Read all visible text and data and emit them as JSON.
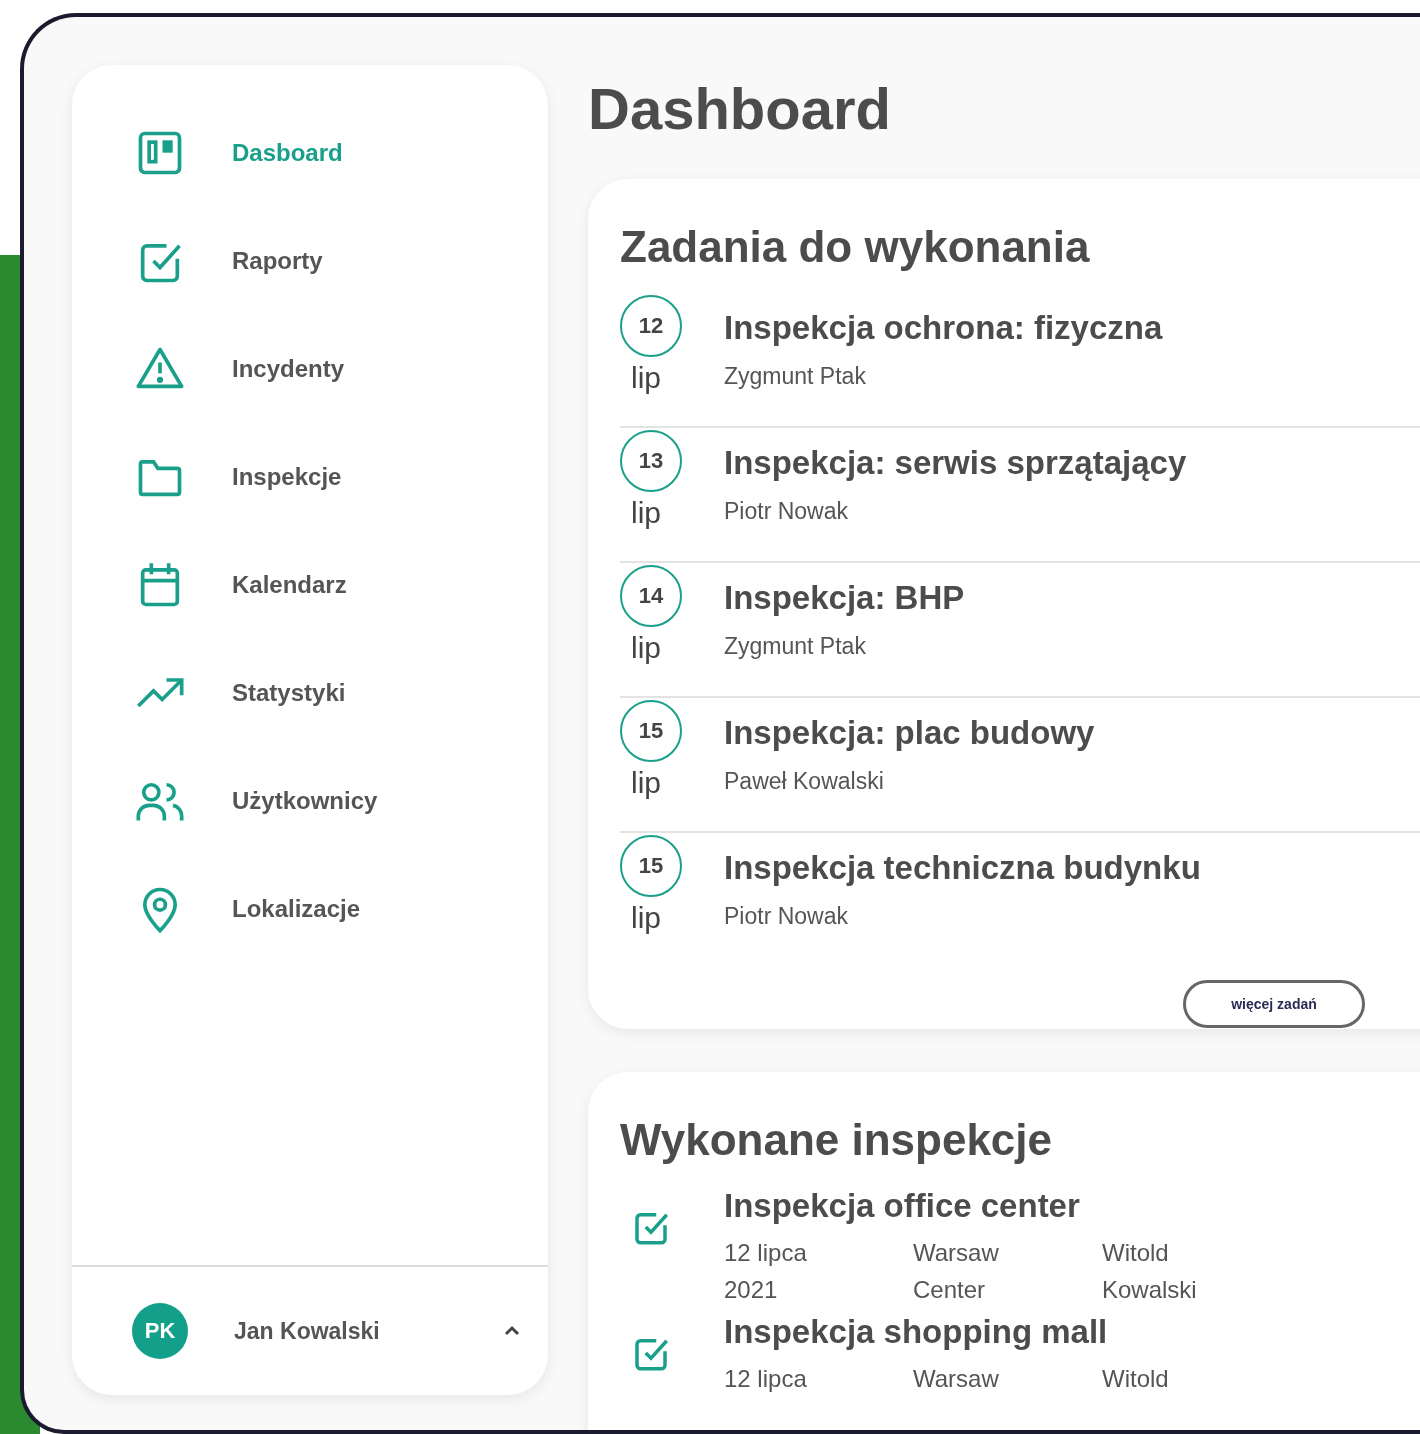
{
  "sidebar": {
    "items": [
      {
        "label": "Dasboard",
        "kind": "board",
        "selected": true
      },
      {
        "label": "Raporty",
        "kind": "check",
        "selected": false
      },
      {
        "label": "Incydenty",
        "kind": "warning",
        "selected": false
      },
      {
        "label": "Inspekcje",
        "kind": "folder",
        "selected": false
      },
      {
        "label": "Kalendarz",
        "kind": "calendar",
        "selected": false
      },
      {
        "label": "Statystyki",
        "kind": "trend",
        "selected": false
      },
      {
        "label": "Użytkownicy",
        "kind": "users",
        "selected": false
      },
      {
        "label": "Lokalizacje",
        "kind": "pin",
        "selected": false
      }
    ],
    "user": {
      "initials": "PK",
      "name": "Jan Kowalski"
    }
  },
  "page_title": "Dashboard",
  "tasks": {
    "title": "Zadania do wykonania",
    "items": [
      {
        "day": "12",
        "month": "lip",
        "title": "Inspekcja ochrona: fizyczna",
        "assignee": "Zygmunt Ptak"
      },
      {
        "day": "13",
        "month": "lip",
        "title": "Inspekcja: serwis sprzątający",
        "assignee": "Piotr Nowak"
      },
      {
        "day": "14",
        "month": "lip",
        "title": "Inspekcja: BHP",
        "assignee": "Zygmunt Ptak"
      },
      {
        "day": "15",
        "month": "lip",
        "title": "Inspekcja: plac budowy",
        "assignee": "Paweł Kowalski"
      },
      {
        "day": "15",
        "month": "lip",
        "title": "Inspekcja techniczna budynku",
        "assignee": "Piotr Nowak"
      }
    ],
    "more_button": "więcej zadań"
  },
  "completed": {
    "title": "Wykonane inspekcje",
    "items": [
      {
        "title": "Inspekcja office center",
        "date": "12 lipca 2021",
        "location": "Warsaw Center",
        "inspector": "Witold Kowalski"
      },
      {
        "title": "Inspekcja shopping mall",
        "date": "12 lipca",
        "location": "Warsaw",
        "inspector": "Witold"
      }
    ]
  }
}
